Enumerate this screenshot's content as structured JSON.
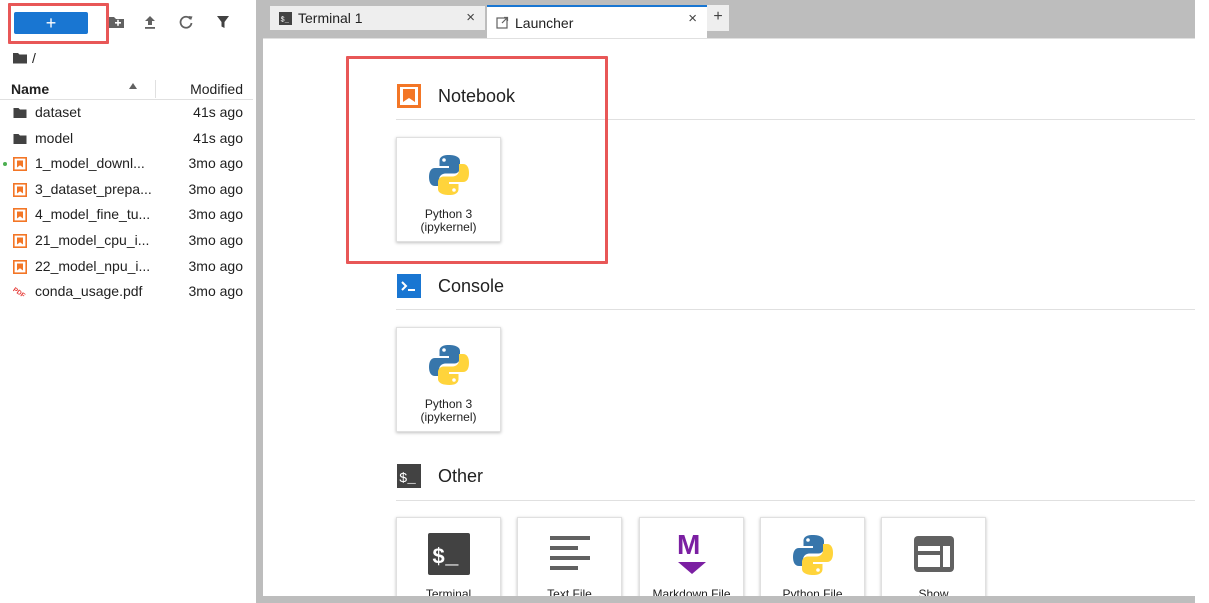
{
  "filebrowser": {
    "new_label": "+",
    "breadcrumb": "/",
    "columns": {
      "name": "Name",
      "modified": "Modified"
    },
    "files": [
      {
        "name": "dataset",
        "modified": "41s ago",
        "kind": "folder-icon",
        "running": false
      },
      {
        "name": "model",
        "modified": "41s ago",
        "kind": "folder-icon",
        "running": false
      },
      {
        "name": "1_model_downl...",
        "modified": "3mo ago",
        "kind": "notebook-icon",
        "running": true
      },
      {
        "name": "3_dataset_prepa...",
        "modified": "3mo ago",
        "kind": "notebook-icon",
        "running": false
      },
      {
        "name": "4_model_fine_tu...",
        "modified": "3mo ago",
        "kind": "notebook-icon",
        "running": false
      },
      {
        "name": "21_model_cpu_i...",
        "modified": "3mo ago",
        "kind": "notebook-icon",
        "running": false
      },
      {
        "name": "22_model_npu_i...",
        "modified": "3mo ago",
        "kind": "notebook-icon",
        "running": false
      },
      {
        "name": "conda_usage.pdf",
        "modified": "3mo ago",
        "kind": "pdf-icon",
        "running": false
      }
    ]
  },
  "tabs": [
    {
      "label": "Terminal 1",
      "close": "×"
    },
    {
      "label": "Launcher",
      "close": "×"
    }
  ],
  "tab_add": "+",
  "launcher": {
    "notebook": {
      "title": "Notebook",
      "cards": [
        {
          "line1": "Python 3",
          "line2": "(ipykernel)"
        }
      ]
    },
    "console": {
      "title": "Console",
      "cards": [
        {
          "line1": "Python 3",
          "line2": "(ipykernel)"
        }
      ]
    },
    "other": {
      "title": "Other",
      "cards": [
        {
          "label": "Terminal"
        },
        {
          "label": "Text File"
        },
        {
          "label": "Markdown File"
        },
        {
          "label": "Python File"
        },
        {
          "label": "Show"
        }
      ]
    }
  },
  "colors": {
    "accent": "#1976d2",
    "highlight": "#e85757",
    "notebook_orange": "#f37626",
    "python_blue": "#3776ab",
    "python_yellow": "#ffd43b",
    "markdown_purple": "#7b1fa2"
  }
}
